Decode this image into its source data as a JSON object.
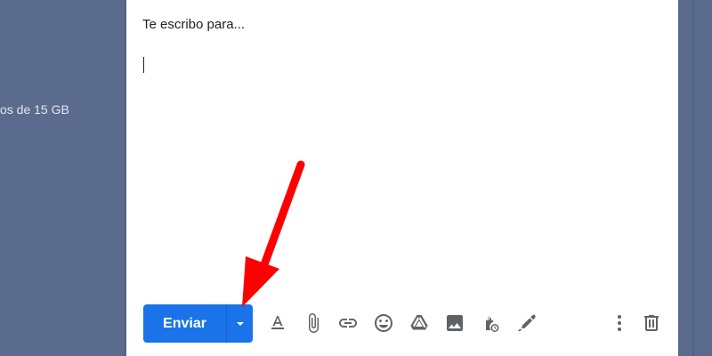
{
  "sidebar": {
    "storage_text": "os de 15 GB"
  },
  "compose": {
    "body_text": "Te escribo para...",
    "send_label": "Enviar"
  },
  "toolbar": {
    "icons": [
      "send-options-dropdown-icon",
      "text-format-icon",
      "attach-file-icon",
      "insert-link-icon",
      "emoji-icon",
      "google-drive-icon",
      "insert-photo-icon",
      "confidential-mode-icon",
      "signature-icon",
      "more-options-icon",
      "discard-draft-icon"
    ]
  },
  "colors": {
    "background": "#5b6b8e",
    "send_button": "#1a73e8",
    "icon_gray": "#5f6368",
    "annotation_arrow": "#ff0000"
  }
}
